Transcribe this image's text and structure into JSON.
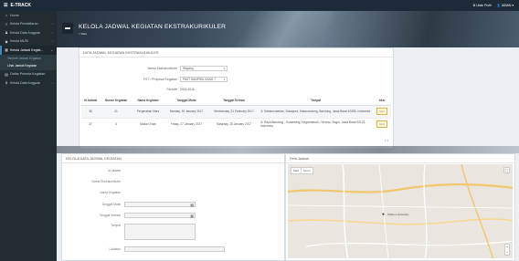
{
  "topbar": {
    "brand": "E-TRACK",
    "links": [
      {
        "label": "Ubah Profil",
        "icon": "gear-icon"
      },
      {
        "label": "ADMIN",
        "icon": "user-icon"
      }
    ]
  },
  "sidebar": {
    "items": [
      {
        "label": "Home",
        "icon": "home-icon"
      },
      {
        "label": "Kelola Pendaftaran",
        "icon": "list-icon"
      },
      {
        "label": "Kelola Data Anggota",
        "icon": "users-icon"
      },
      {
        "label": "Kelola MUSI",
        "icon": "tag-icon"
      },
      {
        "label": "Kelola Jadwal Kegiat...",
        "icon": "calendar-icon"
      }
    ],
    "sub_items": [
      {
        "label": "Tambah Jadwal Kegiatan"
      },
      {
        "label": "Lihat Jadwal Kegiatan"
      }
    ],
    "after_items": [
      {
        "label": "Daftar Peserta Kegiatan",
        "icon": "table-icon"
      },
      {
        "label": "Kelola Data Anggota",
        "icon": "dollar-icon"
      }
    ]
  },
  "hero": {
    "title": "KELOLA JADWAL KEGIATAN EKSTRAKURIKULER",
    "subtitle": "> Data"
  },
  "jadwal_panel": {
    "title": "DATA JADWAL KEGIATAN EKSTRAKULIKULER",
    "filters": [
      {
        "label": "Nama Ekstrakurikuler",
        "value": "Wayang"
      },
      {
        "label": "PST / Proposal Kegiatan",
        "value": "PAST SAMPIRA GANG 7"
      },
      {
        "label": "Periode",
        "value": "2015-2016"
      }
    ],
    "table": {
      "headers": [
        "Id Jadwal",
        "Nomor Kegiatan",
        "Nama Kegiatan",
        "Tanggal Mulai",
        "Tanggal Selesai",
        "Tempat",
        "Aksi"
      ],
      "rows": [
        [
          "38",
          "21",
          "Pergerakan Mars",
          "Monday, 30 January 2017",
          "Wednesday, 31 February 2017",
          "Jl. Sekarmukartan, Sukapura, Kiaracondong, Bandung, Jawa Barat 40285, Indonesia",
          "Edit"
        ],
        [
          "37",
          "4",
          "Makan Enak",
          "Friday, 27 January 2017",
          "Saturday, 28 January 2017",
          "Jl. Raya Bandung - Sumedang, Hegarmanah, Cileunyi, Bogor, Jawa Barat 99123, Indonesia",
          "Edit"
        ]
      ]
    },
    "pager": "1  2"
  },
  "form_panel": {
    "title": "KELOLA DATA JADWAL KEGIATAN",
    "fields": [
      {
        "label": "Id Jadwal"
      },
      {
        "label": "Nama Ekstrakurikuler"
      },
      {
        "label": "Nama Kegiatan"
      },
      {
        "label": "Tanggal Mulai"
      },
      {
        "label": "Tanggal Selesai"
      },
      {
        "label": "Tempat"
      },
      {
        "label": "Lokation"
      }
    ]
  },
  "map_panel": {
    "title": "Peta Jadwal",
    "map_type": [
      "Peta",
      "Satelit"
    ],
    "pin_label": "Telkom University"
  },
  "colors": {
    "topbar": "#1d2b39",
    "sidebar": "#222d32",
    "accent": "#3c8dbc",
    "edit": "#e0b44a"
  }
}
